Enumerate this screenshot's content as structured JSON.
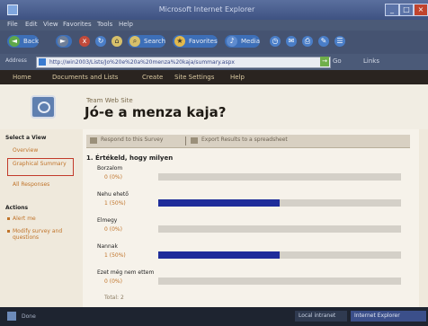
{
  "window": {
    "title": "Microsoft Internet Explorer"
  },
  "menubar": [
    "File",
    "Edit",
    "View",
    "Favorites",
    "Tools",
    "Help"
  ],
  "toolbar": {
    "back": "Back",
    "search": "Search",
    "favorites": "Favorites",
    "media": "Media"
  },
  "address": {
    "label": "Address",
    "url": "http://win2003/Lists/Jo%20e%20a%20menza%20kaja/summary.aspx",
    "go": "Go",
    "links": "Links"
  },
  "spnav": [
    "Home",
    "Documents and Lists",
    "Create",
    "Site Settings",
    "Help"
  ],
  "header": {
    "site_name": "Team Web Site",
    "page_title": "Jó-e a menza kaja?"
  },
  "sidebar": {
    "select_view": "Select a View",
    "views": [
      "Overview",
      "Graphical Summary",
      "All Responses"
    ],
    "actions": "Actions",
    "action_links": [
      "Alert me",
      "Modify survey and questions"
    ]
  },
  "content": {
    "toolbar": [
      "Respond to this Survey",
      "Export Results to a spreadsheet"
    ],
    "question": "1. Értékeld, hogy milyen",
    "options": [
      {
        "label": "Borzalom",
        "pct": "0 (0%)",
        "value": 0
      },
      {
        "label": "Nehu ehető",
        "pct": "1 (50%)",
        "value": 50
      },
      {
        "label": "Elmegy",
        "pct": "0 (0%)",
        "value": 0
      },
      {
        "label": "Nannak",
        "pct": "1 (50%)",
        "value": 50
      },
      {
        "label": "Ezet még nem ettem",
        "pct": "0 (0%)",
        "value": 0
      }
    ],
    "total": "Total: 2"
  },
  "statusbar": {
    "label": "Done",
    "zone": "Local intranet",
    "task": "Internet Explorer"
  },
  "colors": {
    "bar_fill": "#1f2d9a",
    "bar_track": "#d4d0c8",
    "accent": "#c0742a"
  }
}
